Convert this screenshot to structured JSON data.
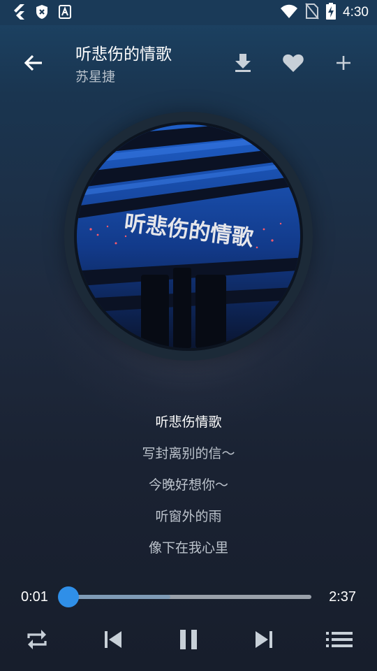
{
  "status_bar": {
    "time": "4:30",
    "left_icons": [
      "flutter-icon",
      "shield-x-icon",
      "android-icon"
    ],
    "right_icons": [
      "wifi-icon",
      "no-sim-icon",
      "battery-charging-icon"
    ]
  },
  "header": {
    "title": "听悲伤的情歌",
    "artist": "苏星捷",
    "actions": [
      "download-icon",
      "heart-icon",
      "add-icon"
    ]
  },
  "album_art": {
    "cover_text": "听悲伤的情歌"
  },
  "lyrics": {
    "current_index": 0,
    "lines": [
      "听悲伤情歌",
      "写封离别的信～",
      "今晚好想你～",
      "听窗外的雨",
      "像下在我心里"
    ]
  },
  "player": {
    "current_time": "0:01",
    "total_time": "2:37",
    "progress_fraction": 0.0,
    "buffered_fraction": 0.42
  },
  "controls": {
    "buttons": [
      "repeat-icon",
      "previous-icon",
      "pause-icon",
      "next-icon",
      "playlist-icon"
    ]
  },
  "colors": {
    "accent": "#2f8fe8",
    "header_bg": "#1a3a58",
    "background_bottom": "#171e2c"
  }
}
